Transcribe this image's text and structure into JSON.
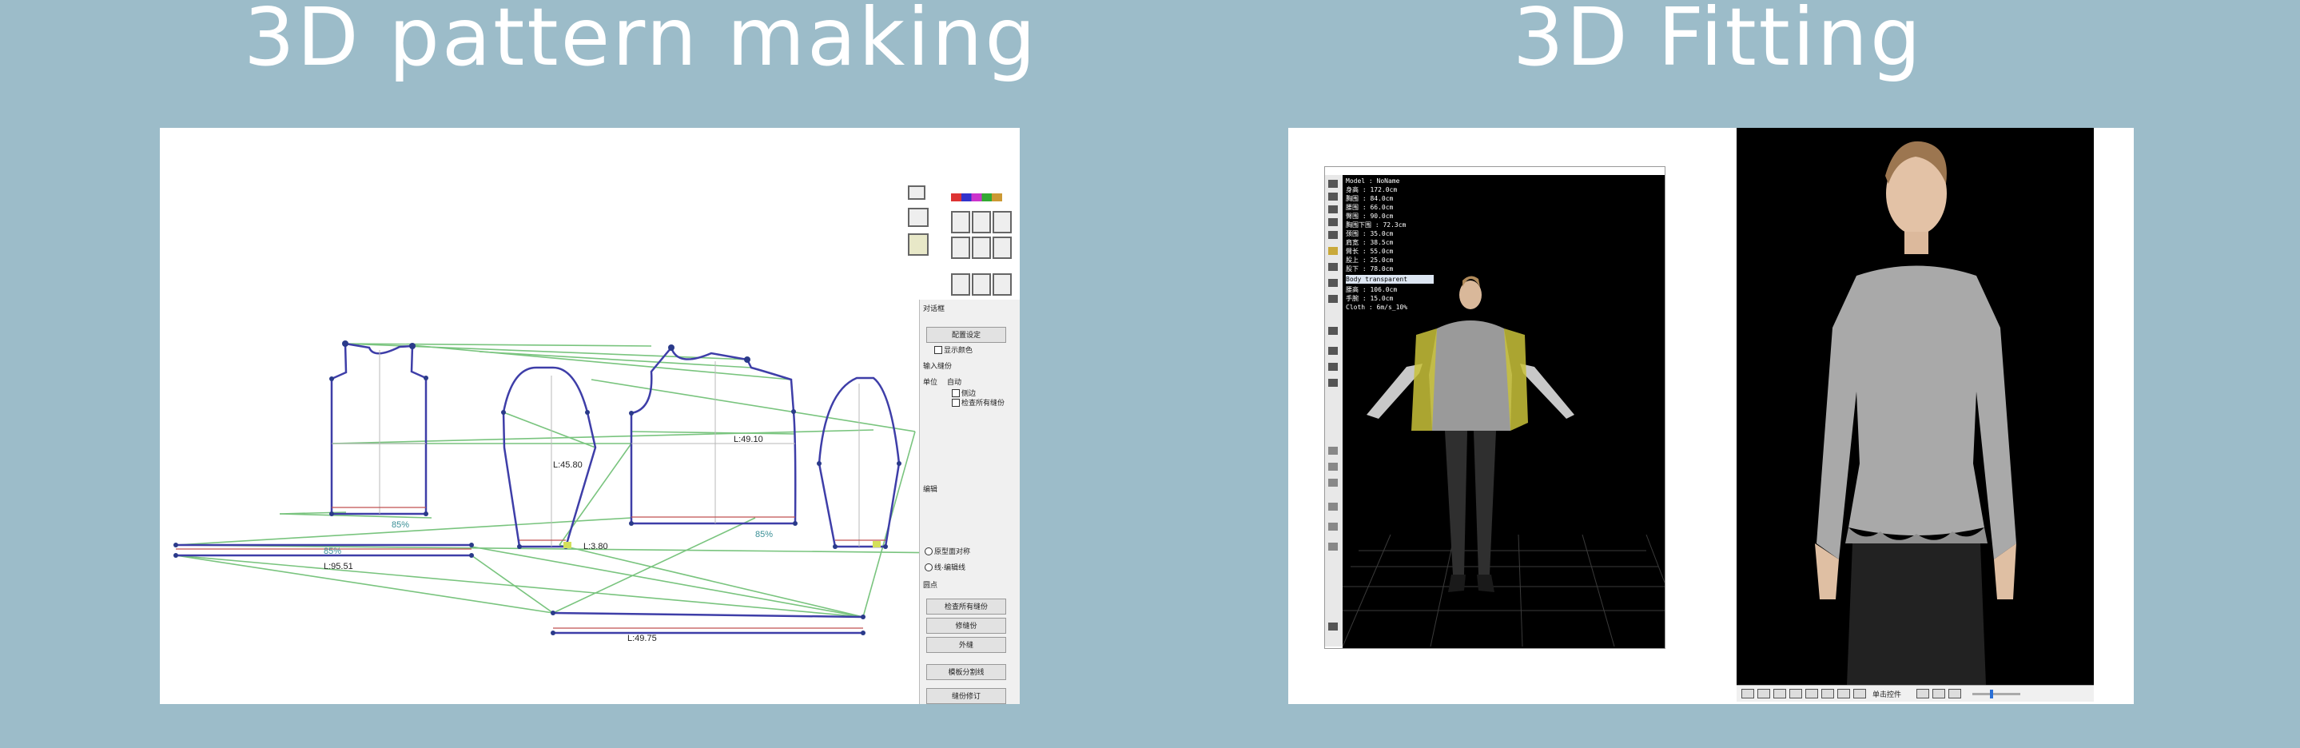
{
  "titles": {
    "left": "3D pattern making",
    "right": "3D Fitting"
  },
  "pattern_view": {
    "measurements": {
      "sleeve_length": "L:45.80",
      "back_length": "L:49.10",
      "left_length": "L:95.51",
      "bottom_length": "L:49.75",
      "small_length": "L:3.80"
    },
    "percent_labels": [
      "85%",
      "85%",
      "85%"
    ],
    "dialog": {
      "header": "对话框",
      "buttons": [
        "配置设定",
        "检查所有缝份",
        "修缝份",
        "外缝",
        "模板分割线",
        "缝份修订"
      ],
      "labels": [
        "显示颜色",
        "输入缝份",
        "单位",
        "自动",
        "侧边",
        "检查所有缝份",
        "编辑",
        "原型面对称",
        "线·编辑线",
        "圆点"
      ]
    }
  },
  "fitting_view": {
    "info_lines": [
      "Model : NoName",
      "身高 : 172.0cm",
      "胸围 : 84.0cm",
      "腰围 : 66.0cm",
      "臀围 : 90.0cm",
      "胸围下围 : 72.3cm",
      "颈围 : 35.0cm",
      "肩宽 : 38.5cm",
      "臂长 : 55.0cm",
      "股上 : 25.0cm",
      "股下 : 78.0cm",
      "腰高 : 106.0cm",
      "手腕 : 15.0cm"
    ],
    "transparency_option": "Body transparent",
    "unit_line": "Cloth : 6m/s_10%",
    "status_text": "单击控件"
  }
}
